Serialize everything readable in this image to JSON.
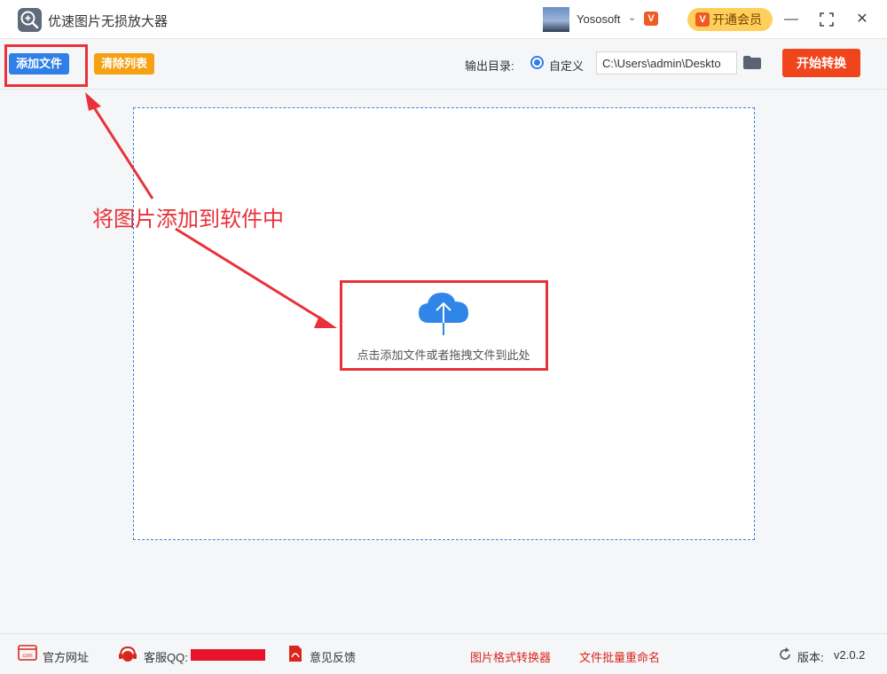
{
  "window": {
    "title": "优速图片无损放大器",
    "username": "Yososoft",
    "vip_badge": "V",
    "open_vip_label": "开通会员",
    "minimize_glyph": "—",
    "maximize_glyph": "⛶",
    "close_glyph": "✕"
  },
  "toolbar": {
    "add_file_label": "添加文件",
    "clear_list_label": "清除列表",
    "output_dir_label": "输出目录:",
    "custom_radio_label": "自定义",
    "output_path_value": "C:\\Users\\admin\\Deskto",
    "start_label": "开始转换"
  },
  "dropzone": {
    "hint": "点击添加文件或者拖拽文件到此处"
  },
  "annotation": {
    "text": "将图片添加到软件中",
    "color": "#e8313a"
  },
  "footer": {
    "website_label": "官方网址",
    "qq_label": "客服QQ:",
    "feedback_label": "意见反馈",
    "converter_link": "图片格式转换器",
    "rename_link": "文件批量重命名",
    "version_label": "版本:",
    "version_value": "v2.0.2"
  },
  "colors": {
    "primary_blue": "#2f7fe6",
    "clear_orange": "#f5a111",
    "start_red": "#f0441c",
    "vip_yellow": "#ffcf5c",
    "link_red": "#d8261c"
  }
}
